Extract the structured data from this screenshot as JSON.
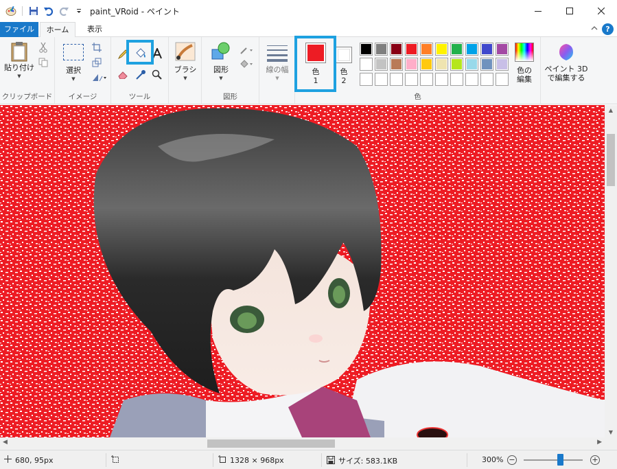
{
  "window": {
    "title": "paint_VRoid - ペイント",
    "controls": [
      "minimize",
      "maximize",
      "close"
    ]
  },
  "tabs": [
    {
      "label": "ファイル"
    },
    {
      "label": "ホーム"
    },
    {
      "label": "表示"
    }
  ],
  "ribbon": {
    "clipboard": {
      "group_label": "クリップボード",
      "paste_label": "貼り付け"
    },
    "image": {
      "group_label": "イメージ",
      "select_label": "選択"
    },
    "tools": {
      "group_label": "ツール",
      "selected_tool": "fill-bucket"
    },
    "brushes": {
      "label": "ブラシ"
    },
    "shapes": {
      "group_label": "図形",
      "shapes_label": "図形"
    },
    "size": {
      "label": "線の幅"
    },
    "colors": {
      "group_label": "色",
      "color1_label": "色",
      "color1_num": "1",
      "color1_value": "#ed1c24",
      "color2_label": "色",
      "color2_num": "2",
      "color2_value": "#ffffff",
      "edit_colors_label_1": "色の",
      "edit_colors_label_2": "編集",
      "palette": [
        "#000000",
        "#7f7f7f",
        "#880015",
        "#ed1c24",
        "#ff7f27",
        "#fff200",
        "#22b14c",
        "#00a2e8",
        "#3f48cc",
        "#a349a4",
        "#ffffff",
        "#c3c3c3",
        "#b97a57",
        "#ffaec9",
        "#ffc90e",
        "#efe4b0",
        "#b5e61d",
        "#99d9ea",
        "#7092be",
        "#c8bfe7",
        "",
        "",
        "",
        "",
        "",
        "",
        "",
        "",
        "",
        ""
      ]
    },
    "paint3d": {
      "label_1": "ペイント 3D",
      "label_2": "で編集する"
    }
  },
  "status": {
    "cursor_pos": "680, 95px",
    "image_size": "1328 × 968px",
    "file_size": "サイズ: 583.1KB",
    "zoom": "300%"
  },
  "canvas": {
    "background_color": "#ed1c24"
  }
}
